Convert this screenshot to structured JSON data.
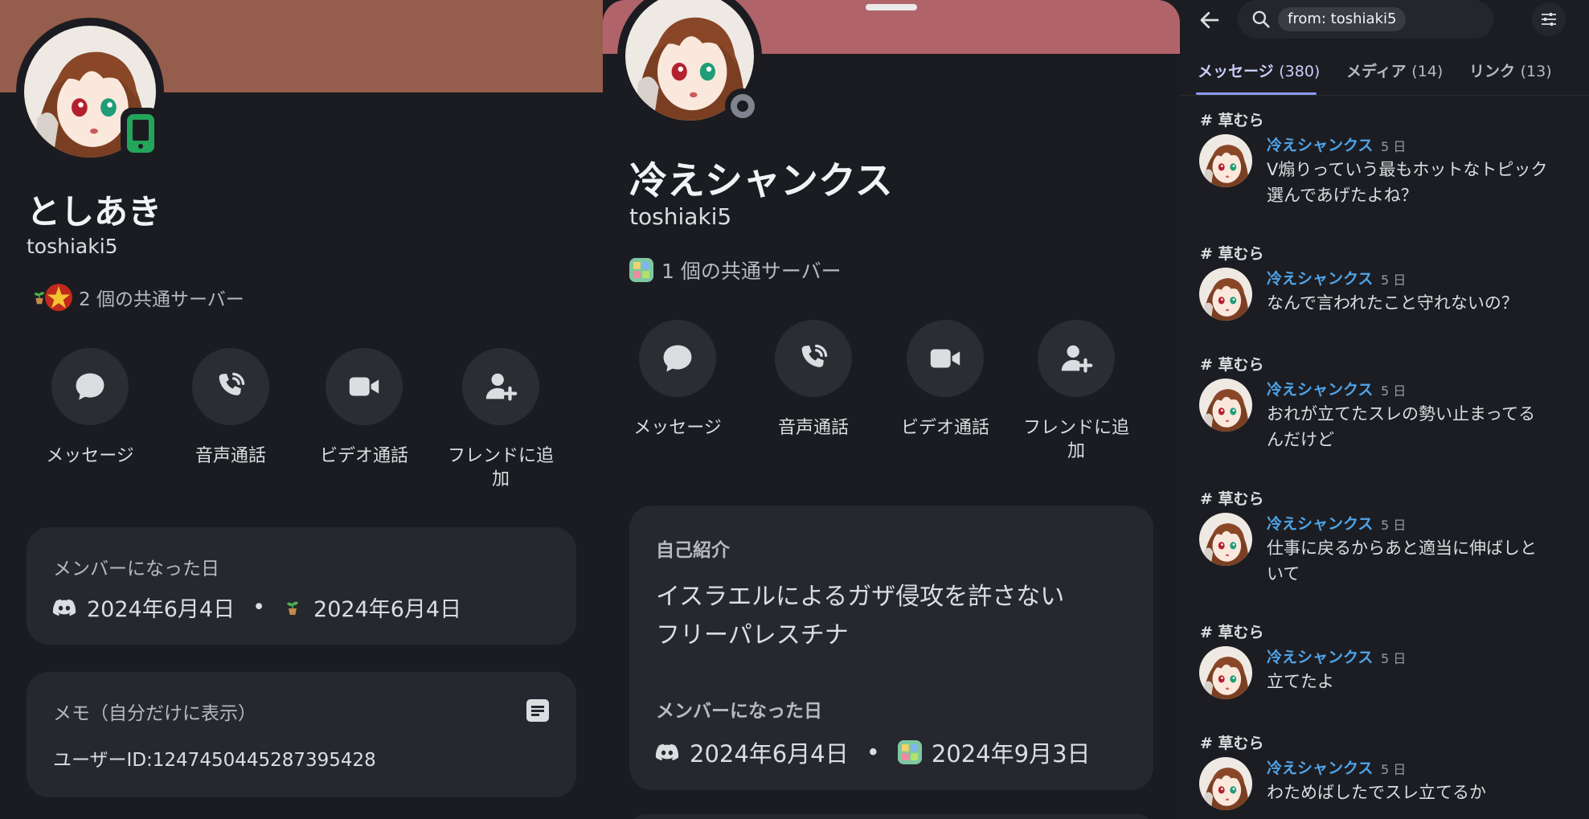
{
  "left_profile": {
    "display_name": "としあき",
    "username": "toshiaki5",
    "status_icon": "mobile-online-icon",
    "mutual_servers": "2 個の共通サーバー",
    "actions": [
      {
        "label": "メッセージ",
        "icon": "chat-bubble-icon"
      },
      {
        "label": "音声通話",
        "icon": "phone-icon"
      },
      {
        "label": "ビデオ通話",
        "icon": "video-camera-icon"
      },
      {
        "label": "フレンドに追加",
        "icon": "add-friend-icon"
      }
    ],
    "member_since": {
      "title": "メンバーになった日",
      "discord_date": "2024年6月4日",
      "separator": "•",
      "server_date": "2024年6月4日"
    },
    "memo": {
      "title": "メモ（自分だけに表示）",
      "content": "ユーザーID:1247450445287395428"
    }
  },
  "middle_profile": {
    "display_name": "冷えシャンクス",
    "username": "toshiaki5",
    "mutual_servers": "1 個の共通サーバー",
    "actions": [
      {
        "label": "メッセージ",
        "icon": "chat-bubble-icon"
      },
      {
        "label": "音声通話",
        "icon": "phone-icon"
      },
      {
        "label": "ビデオ通話",
        "icon": "video-camera-icon"
      },
      {
        "label": "フレンドに追加",
        "icon": "add-friend-icon"
      }
    ],
    "bio": {
      "title": "自己紹介",
      "line1": "イスラエルによるガザ侵攻を許さない",
      "line2": "フリーパレスチナ"
    },
    "member_since": {
      "title": "メンバーになった日",
      "discord_date": "2024年6月4日",
      "separator": "•",
      "server_date": "2024年9月3日"
    }
  },
  "search": {
    "query_chip": "from: toshiaki5",
    "tabs": [
      {
        "label": "メッセージ",
        "count": "(380)"
      },
      {
        "label": "メディア",
        "count": "(14)"
      },
      {
        "label": "リンク",
        "count": "(13)"
      }
    ],
    "results": [
      {
        "channel": "草むら",
        "author": "冷えシャンクス",
        "time": "5 日",
        "lines": [
          "V煽りっていう最もホットなトピック",
          "選んであげたよね？"
        ]
      },
      {
        "channel": "草むら",
        "author": "冷えシャンクス",
        "time": "5 日",
        "lines": [
          "なんで言われたこと守れないの？"
        ]
      },
      {
        "channel": "草むら",
        "author": "冷えシャンクス",
        "time": "5 日",
        "lines": [
          "おれが立てたスレの勢い止まってる",
          "んだけど"
        ]
      },
      {
        "channel": "草むら",
        "author": "冷えシャンクス",
        "time": "5 日",
        "lines": [
          "仕事に戻るからあと適当に伸ばしと",
          "いて"
        ]
      },
      {
        "channel": "草むら",
        "author": "冷えシャンクス",
        "time": "5 日",
        "lines": [
          "立てたよ"
        ]
      },
      {
        "channel": "草むら",
        "author": "冷えシャンクス",
        "time": "5 日",
        "lines": [
          "わためばしたでスレ立てるか"
        ]
      }
    ]
  },
  "colors": {
    "banner_left": "#955d4b",
    "banner_middle": "#b0646a",
    "author_blue": "#4ea4ea",
    "tab_active": "#c9cdfb",
    "online_green": "#23a55a"
  }
}
